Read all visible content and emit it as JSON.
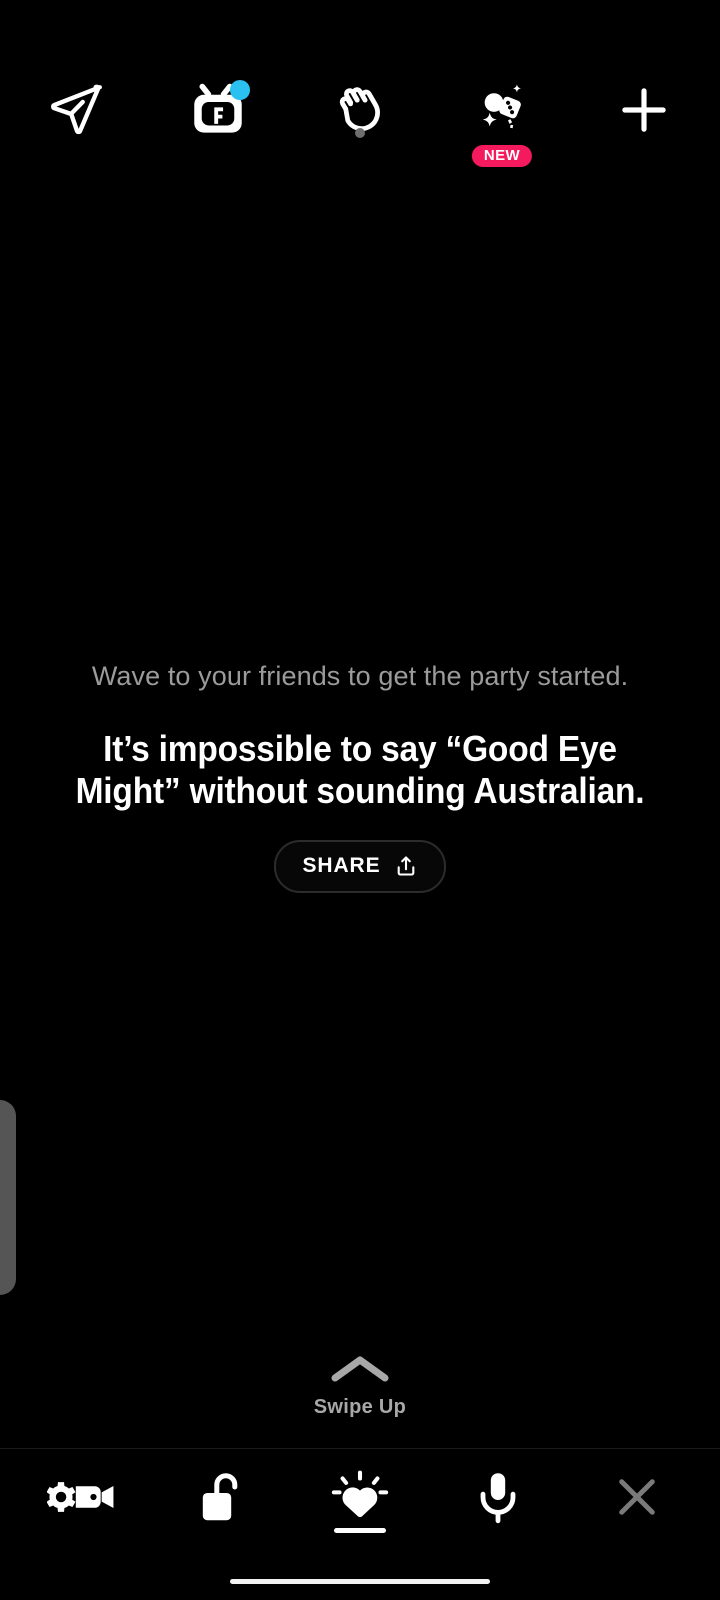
{
  "app": {
    "background_color": "#000000",
    "accent_new_badge": "#f5195e",
    "accent_notification_dot": "#2ac0f0"
  },
  "top_bar": {
    "items": [
      {
        "name": "send-icon",
        "label": "Send",
        "icon": "paper-plane-icon",
        "badge": null
      },
      {
        "name": "watch-icon",
        "label": "Watch",
        "icon": "tv-f-icon",
        "badge": "dot",
        "badge_color": "#2ac0f0"
      },
      {
        "name": "wave-icon",
        "label": "Wave",
        "icon": "waving-hand-icon",
        "badge": "gray-dot"
      },
      {
        "name": "games-icon",
        "label": "Games",
        "icon": "games-sparkle-icon",
        "badge": "NEW",
        "badge_color": "#f5195e"
      },
      {
        "name": "add-icon",
        "label": "Add",
        "icon": "plus-icon",
        "badge": null
      }
    ],
    "new_badge_text": "NEW"
  },
  "center": {
    "subtitle": "Wave to your friends to get the party started.",
    "headline": "It’s impossible to say “Good Eye Might” without sounding Australian.",
    "share_label": "SHARE"
  },
  "swipe": {
    "label": "Swipe Up",
    "chevron_color": "#a8a8a8"
  },
  "bottom_bar": {
    "items": [
      {
        "name": "camera-settings",
        "label": "Camera settings",
        "icon": "gear-camera-icon",
        "active": false,
        "color": "#ffffff"
      },
      {
        "name": "lock-room",
        "label": "Lock room",
        "icon": "unlocked-padlock-icon",
        "active": false,
        "color": "#ffffff"
      },
      {
        "name": "effects",
        "label": "Effects",
        "icon": "shining-heart-icon",
        "active": true,
        "color": "#ffffff"
      },
      {
        "name": "microphone",
        "label": "Microphone",
        "icon": "microphone-icon",
        "active": false,
        "color": "#ffffff"
      },
      {
        "name": "close",
        "label": "Close",
        "icon": "close-x-icon",
        "active": false,
        "color": "#7a7a7a"
      }
    ]
  },
  "edge_handle": {
    "name": "drawer-handle",
    "color": "#555555"
  }
}
